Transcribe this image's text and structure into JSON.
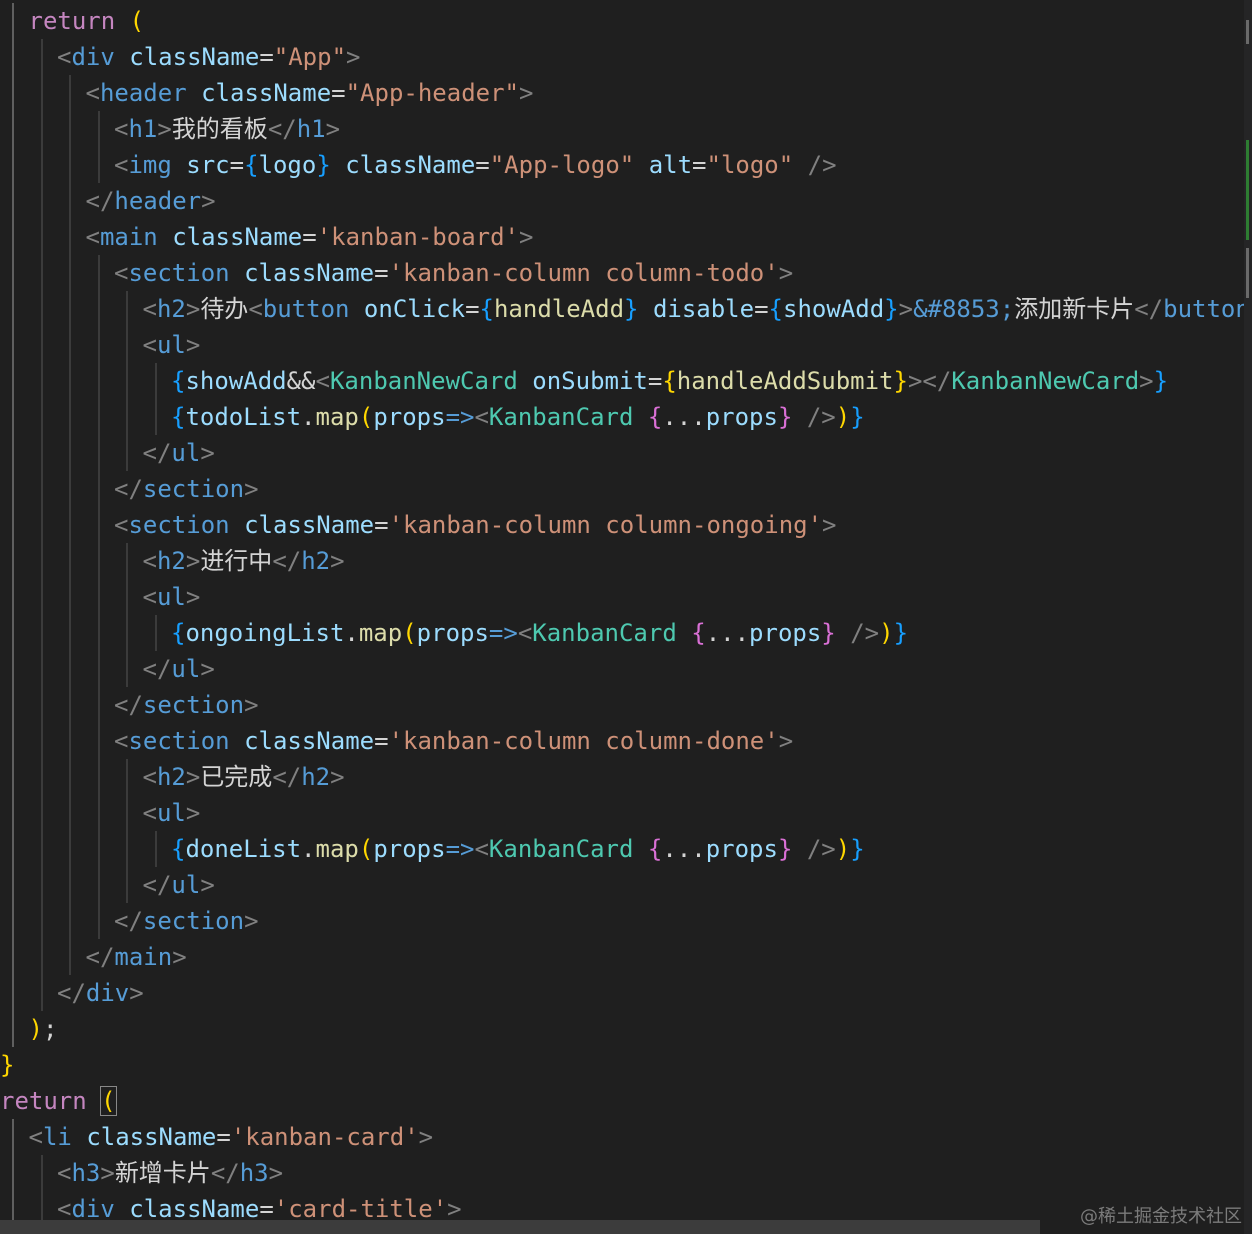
{
  "editor": {
    "language": "jsx",
    "theme_colors": {
      "background": "#1f1f1f",
      "keyword": "#c586c0",
      "tag": "#569cd6",
      "component": "#4ec9b0",
      "attribute": "#9cdcfe",
      "string": "#ce9178",
      "bracket_gold": "#ffd700",
      "bracket_pink": "#da70d6",
      "bracket_blue": "#179fff"
    },
    "lines": [
      [
        [
          "tk-kw",
          "return"
        ],
        [
          "tk-text",
          " "
        ],
        [
          "tk-brace1",
          "("
        ]
      ],
      [
        [
          "tk-punc",
          "<"
        ],
        [
          "tk-tag",
          "div"
        ],
        [
          "tk-text",
          " "
        ],
        [
          "tk-attr",
          "className"
        ],
        [
          "tk-op",
          "="
        ],
        [
          "tk-str",
          "\"App\""
        ],
        [
          "tk-punc",
          ">"
        ]
      ],
      [
        [
          "tk-punc",
          "<"
        ],
        [
          "tk-tag",
          "header"
        ],
        [
          "tk-text",
          " "
        ],
        [
          "tk-attr",
          "className"
        ],
        [
          "tk-op",
          "="
        ],
        [
          "tk-str",
          "\"App-header\""
        ],
        [
          "tk-punc",
          ">"
        ]
      ],
      [
        [
          "tk-punc",
          "<"
        ],
        [
          "tk-tag",
          "h1"
        ],
        [
          "tk-punc",
          ">"
        ],
        [
          "tk-text",
          "我的看板"
        ],
        [
          "tk-punc",
          "</"
        ],
        [
          "tk-tag",
          "h1"
        ],
        [
          "tk-punc",
          ">"
        ]
      ],
      [
        [
          "tk-punc",
          "<"
        ],
        [
          "tk-tag",
          "img"
        ],
        [
          "tk-text",
          " "
        ],
        [
          "tk-attr",
          "src"
        ],
        [
          "tk-op",
          "="
        ],
        [
          "tk-brace3",
          "{"
        ],
        [
          "tk-var",
          "logo"
        ],
        [
          "tk-brace3",
          "}"
        ],
        [
          "tk-text",
          " "
        ],
        [
          "tk-attr",
          "className"
        ],
        [
          "tk-op",
          "="
        ],
        [
          "tk-str",
          "\"App-logo\""
        ],
        [
          "tk-text",
          " "
        ],
        [
          "tk-attr",
          "alt"
        ],
        [
          "tk-op",
          "="
        ],
        [
          "tk-str",
          "\"logo\""
        ],
        [
          "tk-text",
          " "
        ],
        [
          "tk-punc",
          "/>"
        ]
      ],
      [
        [
          "tk-punc",
          "</"
        ],
        [
          "tk-tag",
          "header"
        ],
        [
          "tk-punc",
          ">"
        ]
      ],
      [
        [
          "tk-punc",
          "<"
        ],
        [
          "tk-tag",
          "main"
        ],
        [
          "tk-text",
          " "
        ],
        [
          "tk-attr",
          "className"
        ],
        [
          "tk-op",
          "="
        ],
        [
          "tk-str",
          "'kanban-board'"
        ],
        [
          "tk-punc",
          ">"
        ]
      ],
      [
        [
          "tk-punc",
          "<"
        ],
        [
          "tk-tag",
          "section"
        ],
        [
          "tk-text",
          " "
        ],
        [
          "tk-attr",
          "className"
        ],
        [
          "tk-op",
          "="
        ],
        [
          "tk-str",
          "'kanban-column column-todo'"
        ],
        [
          "tk-punc",
          ">"
        ]
      ],
      [
        [
          "tk-punc",
          "<"
        ],
        [
          "tk-tag",
          "h2"
        ],
        [
          "tk-punc",
          ">"
        ],
        [
          "tk-text",
          "待办"
        ],
        [
          "tk-punc",
          "<"
        ],
        [
          "tk-tag",
          "button"
        ],
        [
          "tk-text",
          " "
        ],
        [
          "tk-attr",
          "onClick"
        ],
        [
          "tk-op",
          "="
        ],
        [
          "tk-brace3",
          "{"
        ],
        [
          "tk-fn",
          "handleAdd"
        ],
        [
          "tk-brace3",
          "}"
        ],
        [
          "tk-text",
          " "
        ],
        [
          "tk-attr",
          "disable"
        ],
        [
          "tk-op",
          "="
        ],
        [
          "tk-brace3",
          "{"
        ],
        [
          "tk-var",
          "showAdd"
        ],
        [
          "tk-brace3",
          "}"
        ],
        [
          "tk-punc",
          ">"
        ],
        [
          "tk-ent",
          "&#8853;"
        ],
        [
          "tk-text",
          "添加新卡片"
        ],
        [
          "tk-punc",
          "</"
        ],
        [
          "tk-tag",
          "button"
        ]
      ],
      [
        [
          "tk-punc",
          "<"
        ],
        [
          "tk-tag",
          "ul"
        ],
        [
          "tk-punc",
          ">"
        ]
      ],
      [
        [
          "tk-brace3",
          "{"
        ],
        [
          "tk-var",
          "showAdd"
        ],
        [
          "tk-op",
          "&&"
        ],
        [
          "tk-punc",
          "<"
        ],
        [
          "tk-cmp",
          "KanbanNewCard"
        ],
        [
          "tk-text",
          " "
        ],
        [
          "tk-attr",
          "onSubmit"
        ],
        [
          "tk-op",
          "="
        ],
        [
          "tk-brace1",
          "{"
        ],
        [
          "tk-fn",
          "handleAddSubmit"
        ],
        [
          "tk-brace1",
          "}"
        ],
        [
          "tk-punc",
          "></"
        ],
        [
          "tk-cmp",
          "KanbanNewCard"
        ],
        [
          "tk-punc",
          ">"
        ],
        [
          "tk-brace3",
          "}"
        ]
      ],
      [
        [
          "tk-brace3",
          "{"
        ],
        [
          "tk-var",
          "todoList"
        ],
        [
          "tk-op",
          "."
        ],
        [
          "tk-fn",
          "map"
        ],
        [
          "tk-brace1",
          "("
        ],
        [
          "tk-var",
          "props"
        ],
        [
          "tk-tag",
          "=>"
        ],
        [
          "tk-punc",
          "<"
        ],
        [
          "tk-cmp",
          "KanbanCard"
        ],
        [
          "tk-text",
          " "
        ],
        [
          "tk-brace2",
          "{"
        ],
        [
          "tk-op",
          "..."
        ],
        [
          "tk-var",
          "props"
        ],
        [
          "tk-brace2",
          "}"
        ],
        [
          "tk-text",
          " "
        ],
        [
          "tk-punc",
          "/>"
        ],
        [
          "tk-brace1",
          ")"
        ],
        [
          "tk-brace3",
          "}"
        ]
      ],
      [
        [
          "tk-punc",
          "</"
        ],
        [
          "tk-tag",
          "ul"
        ],
        [
          "tk-punc",
          ">"
        ]
      ],
      [
        [
          "tk-punc",
          "</"
        ],
        [
          "tk-tag",
          "section"
        ],
        [
          "tk-punc",
          ">"
        ]
      ],
      [
        [
          "tk-punc",
          "<"
        ],
        [
          "tk-tag",
          "section"
        ],
        [
          "tk-text",
          " "
        ],
        [
          "tk-attr",
          "className"
        ],
        [
          "tk-op",
          "="
        ],
        [
          "tk-str",
          "'kanban-column column-ongoing'"
        ],
        [
          "tk-punc",
          ">"
        ]
      ],
      [
        [
          "tk-punc",
          "<"
        ],
        [
          "tk-tag",
          "h2"
        ],
        [
          "tk-punc",
          ">"
        ],
        [
          "tk-text",
          "进行中"
        ],
        [
          "tk-punc",
          "</"
        ],
        [
          "tk-tag",
          "h2"
        ],
        [
          "tk-punc",
          ">"
        ]
      ],
      [
        [
          "tk-punc",
          "<"
        ],
        [
          "tk-tag",
          "ul"
        ],
        [
          "tk-punc",
          ">"
        ]
      ],
      [
        [
          "tk-brace3",
          "{"
        ],
        [
          "tk-var",
          "ongoingList"
        ],
        [
          "tk-op",
          "."
        ],
        [
          "tk-fn",
          "map"
        ],
        [
          "tk-brace1",
          "("
        ],
        [
          "tk-var",
          "props"
        ],
        [
          "tk-tag",
          "=>"
        ],
        [
          "tk-punc",
          "<"
        ],
        [
          "tk-cmp",
          "KanbanCard"
        ],
        [
          "tk-text",
          " "
        ],
        [
          "tk-brace2",
          "{"
        ],
        [
          "tk-op",
          "..."
        ],
        [
          "tk-var",
          "props"
        ],
        [
          "tk-brace2",
          "}"
        ],
        [
          "tk-text",
          " "
        ],
        [
          "tk-punc",
          "/>"
        ],
        [
          "tk-brace1",
          ")"
        ],
        [
          "tk-brace3",
          "}"
        ]
      ],
      [
        [
          "tk-punc",
          "</"
        ],
        [
          "tk-tag",
          "ul"
        ],
        [
          "tk-punc",
          ">"
        ]
      ],
      [
        [
          "tk-punc",
          "</"
        ],
        [
          "tk-tag",
          "section"
        ],
        [
          "tk-punc",
          ">"
        ]
      ],
      [
        [
          "tk-punc",
          "<"
        ],
        [
          "tk-tag",
          "section"
        ],
        [
          "tk-text",
          " "
        ],
        [
          "tk-attr",
          "className"
        ],
        [
          "tk-op",
          "="
        ],
        [
          "tk-str",
          "'kanban-column column-done'"
        ],
        [
          "tk-punc",
          ">"
        ]
      ],
      [
        [
          "tk-punc",
          "<"
        ],
        [
          "tk-tag",
          "h2"
        ],
        [
          "tk-punc",
          ">"
        ],
        [
          "tk-text",
          "已完成"
        ],
        [
          "tk-punc",
          "</"
        ],
        [
          "tk-tag",
          "h2"
        ],
        [
          "tk-punc",
          ">"
        ]
      ],
      [
        [
          "tk-punc",
          "<"
        ],
        [
          "tk-tag",
          "ul"
        ],
        [
          "tk-punc",
          ">"
        ]
      ],
      [
        [
          "tk-brace3",
          "{"
        ],
        [
          "tk-var",
          "doneList"
        ],
        [
          "tk-op",
          "."
        ],
        [
          "tk-fn",
          "map"
        ],
        [
          "tk-brace1",
          "("
        ],
        [
          "tk-var",
          "props"
        ],
        [
          "tk-tag",
          "=>"
        ],
        [
          "tk-punc",
          "<"
        ],
        [
          "tk-cmp",
          "KanbanCard"
        ],
        [
          "tk-text",
          " "
        ],
        [
          "tk-brace2",
          "{"
        ],
        [
          "tk-op",
          "..."
        ],
        [
          "tk-var",
          "props"
        ],
        [
          "tk-brace2",
          "}"
        ],
        [
          "tk-text",
          " "
        ],
        [
          "tk-punc",
          "/>"
        ],
        [
          "tk-brace1",
          ")"
        ],
        [
          "tk-brace3",
          "}"
        ]
      ],
      [
        [
          "tk-punc",
          "</"
        ],
        [
          "tk-tag",
          "ul"
        ],
        [
          "tk-punc",
          ">"
        ]
      ],
      [
        [
          "tk-punc",
          "</"
        ],
        [
          "tk-tag",
          "section"
        ],
        [
          "tk-punc",
          ">"
        ]
      ],
      [
        [
          "tk-punc",
          "</"
        ],
        [
          "tk-tag",
          "main"
        ],
        [
          "tk-punc",
          ">"
        ]
      ],
      [
        [
          "tk-punc",
          "</"
        ],
        [
          "tk-tag",
          "div"
        ],
        [
          "tk-punc",
          ">"
        ]
      ],
      [
        [
          "tk-brace1",
          ")"
        ],
        [
          "tk-text",
          ";"
        ]
      ],
      [
        [
          "tk-brace1",
          "}"
        ]
      ],
      [
        [
          "tk-kw",
          "return"
        ],
        [
          "tk-text",
          " "
        ],
        [
          "tk-brace1 bracket-match",
          "("
        ]
      ],
      [
        [
          "tk-punc",
          "<"
        ],
        [
          "tk-tag",
          "li"
        ],
        [
          "tk-text",
          " "
        ],
        [
          "tk-attr",
          "className"
        ],
        [
          "tk-op",
          "="
        ],
        [
          "tk-str",
          "'kanban-card'"
        ],
        [
          "tk-punc",
          ">"
        ]
      ],
      [
        [
          "tk-punc",
          "<"
        ],
        [
          "tk-tag",
          "h3"
        ],
        [
          "tk-punc",
          ">"
        ],
        [
          "tk-text",
          "新增卡片"
        ],
        [
          "tk-punc",
          "</"
        ],
        [
          "tk-tag",
          "h3"
        ],
        [
          "tk-punc",
          ">"
        ]
      ],
      [
        [
          "tk-punc",
          "<"
        ],
        [
          "tk-tag",
          "div"
        ],
        [
          "tk-text",
          " "
        ],
        [
          "tk-attr",
          "className"
        ],
        [
          "tk-op",
          "="
        ],
        [
          "tk-str",
          "'card-title'"
        ],
        [
          "tk-punc",
          ">"
        ]
      ]
    ]
  },
  "watermark": "@稀土掘金技术社区"
}
